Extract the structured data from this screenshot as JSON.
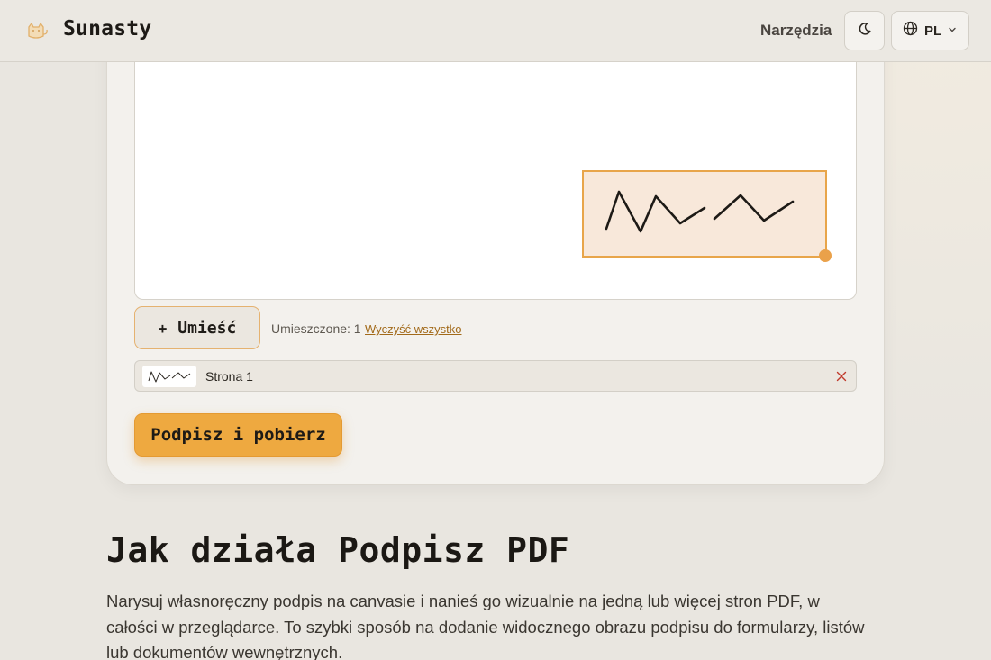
{
  "header": {
    "brand": "Sunasty",
    "nav_tools": "Narzędzia",
    "theme_icon": "moon-icon",
    "language": "PL",
    "language_icon": "globe-icon"
  },
  "signing": {
    "place_button": "Umieść",
    "place_icon": "plus-icon",
    "placed_count": "Umieszczone: 1",
    "clear_all": "Wyczyść wszystko",
    "placed_items": [
      {
        "label": "Strona 1"
      }
    ],
    "sign_button": "Podpisz i pobierz"
  },
  "info": {
    "title": "Jak działa Podpisz PDF",
    "description": "Narysuj własnoręczny podpis na canvasie i nanieś go wizualnie na jedną lub więcej stron PDF, w całości w przeglądarce. To szybki sposób na dodanie widocznego obrazu podpisu do formularzy, listów lub dokumentów wewnętrznych."
  },
  "colors": {
    "accent": "#eea940",
    "accent_border": "#e8a54a",
    "signature_fill": "#f8e8da",
    "page_bg": "#e9e6e0",
    "remove": "#c0392b"
  }
}
